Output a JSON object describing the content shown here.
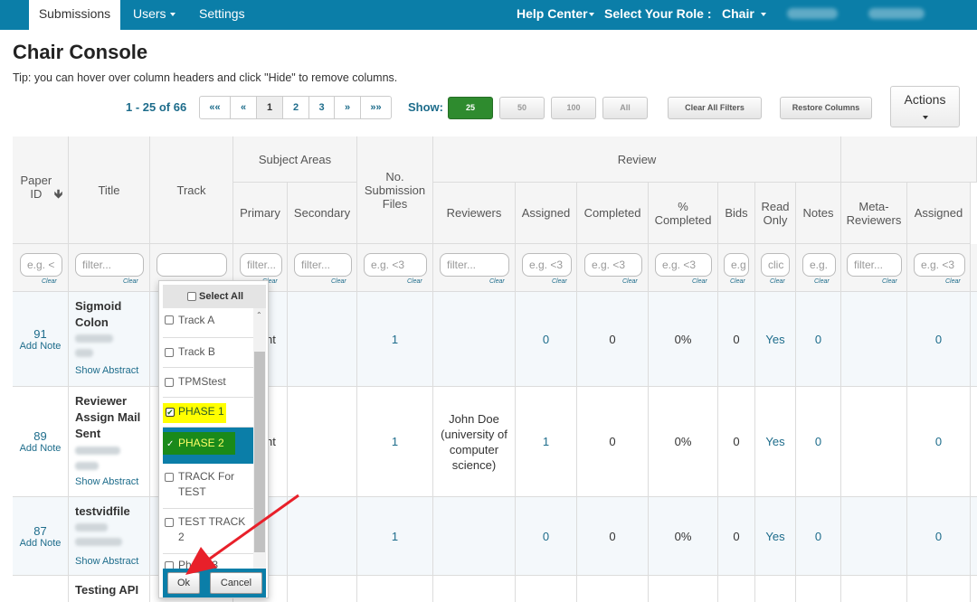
{
  "nav": {
    "tabs": [
      "Submissions",
      "Users",
      "Settings"
    ],
    "help_center": "Help Center",
    "role_label": "Select Your Role :",
    "role_value": "Chair"
  },
  "page": {
    "title": "Chair Console",
    "tip": "Tip: you can hover over column headers and click \"Hide\" to remove columns."
  },
  "pager": {
    "range": "1 - 25 of 66",
    "buttons": [
      "««",
      "«",
      "1",
      "2",
      "3",
      "»",
      "»»"
    ],
    "current_page": "1",
    "show_label": "Show:",
    "show_options": [
      "25",
      "50",
      "100",
      "All"
    ],
    "show_selected": "25",
    "clear_filters": "Clear All Filters",
    "restore_columns": "Restore Columns",
    "actions": "Actions"
  },
  "table": {
    "group_headers": {
      "subject_areas": "Subject Areas",
      "review": "Review"
    },
    "columns": {
      "paper_id": "Paper ID",
      "title": "Title",
      "track": "Track",
      "primary": "Primary",
      "secondary": "Secondary",
      "no_files": "No. Submission Files",
      "reviewers": "Reviewers",
      "assigned": "Assigned",
      "completed": "Completed",
      "pct_completed": "% Completed",
      "bids": "Bids",
      "read_only": "Read Only",
      "notes": "Notes",
      "meta_reviewers": "Meta-Reviewers",
      "meta_assigned": "Assigned"
    },
    "filters": {
      "paper_id": "e.g. <",
      "title": "filter...",
      "track": "",
      "primary": "filter...",
      "secondary": "filter...",
      "no_files": "e.g. <3",
      "reviewers": "filter...",
      "assigned": "e.g. <3",
      "completed": "e.g. <3",
      "pct_completed": "e.g. <3",
      "bids": "e.g",
      "read_only": "clic",
      "notes": "e.g.",
      "meta_reviewers": "filter...",
      "meta_assigned": "e.g. <3",
      "clear": "Clear"
    },
    "add_note": "Add Note",
    "show_abstract": "Show Abstract",
    "rows": [
      {
        "id": "91",
        "title_line1": "Sigmoid",
        "title_line2": "Colon",
        "primary_fragment": "nt",
        "files": "1",
        "reviewers": "",
        "assigned": "0",
        "completed": "0",
        "pct": "0%",
        "bids": "0",
        "read_only": "Yes",
        "notes": "0",
        "meta_assigned": "0"
      },
      {
        "id": "89",
        "title_line1": "Reviewer",
        "title_line2": "Assign Mail",
        "title_line3": "Sent",
        "primary_fragment": "nt",
        "files": "1",
        "reviewers_lines": [
          "John Doe",
          "(university of",
          "computer",
          "science)"
        ],
        "assigned": "1",
        "completed": "0",
        "pct": "0%",
        "bids": "0",
        "read_only": "Yes",
        "notes": "0",
        "meta_assigned": "0"
      },
      {
        "id": "87",
        "title_line1": "testvidfile",
        "files": "1",
        "assigned": "0",
        "completed": "0",
        "pct": "0%",
        "bids": "0",
        "read_only": "Yes",
        "notes": "0",
        "meta_assigned": "0"
      },
      {
        "title_line1": "Testing API"
      }
    ]
  },
  "track_filter": {
    "select_all": "Select All",
    "options": [
      {
        "label": "Track A",
        "checked": false
      },
      {
        "label": "Track B",
        "checked": false
      },
      {
        "label": "TPMStest",
        "checked": false
      },
      {
        "label": "PHASE 1",
        "checked": true
      },
      {
        "label": "PHASE 2",
        "checked": true
      },
      {
        "label": "TRACK For TEST",
        "checked": false
      },
      {
        "label": "TEST TRACK 2",
        "checked": false
      },
      {
        "label": "Phase 3",
        "checked": false
      }
    ],
    "ok": "Ok",
    "cancel": "Cancel"
  },
  "colors": {
    "navbar": "#0b7ea8",
    "link": "#1d6c8b",
    "show_active": "#2e8b2e",
    "highlight_yellow": "#ffff00",
    "highlight_green": "#1a8a1a",
    "arrow_red": "#e8202a"
  }
}
